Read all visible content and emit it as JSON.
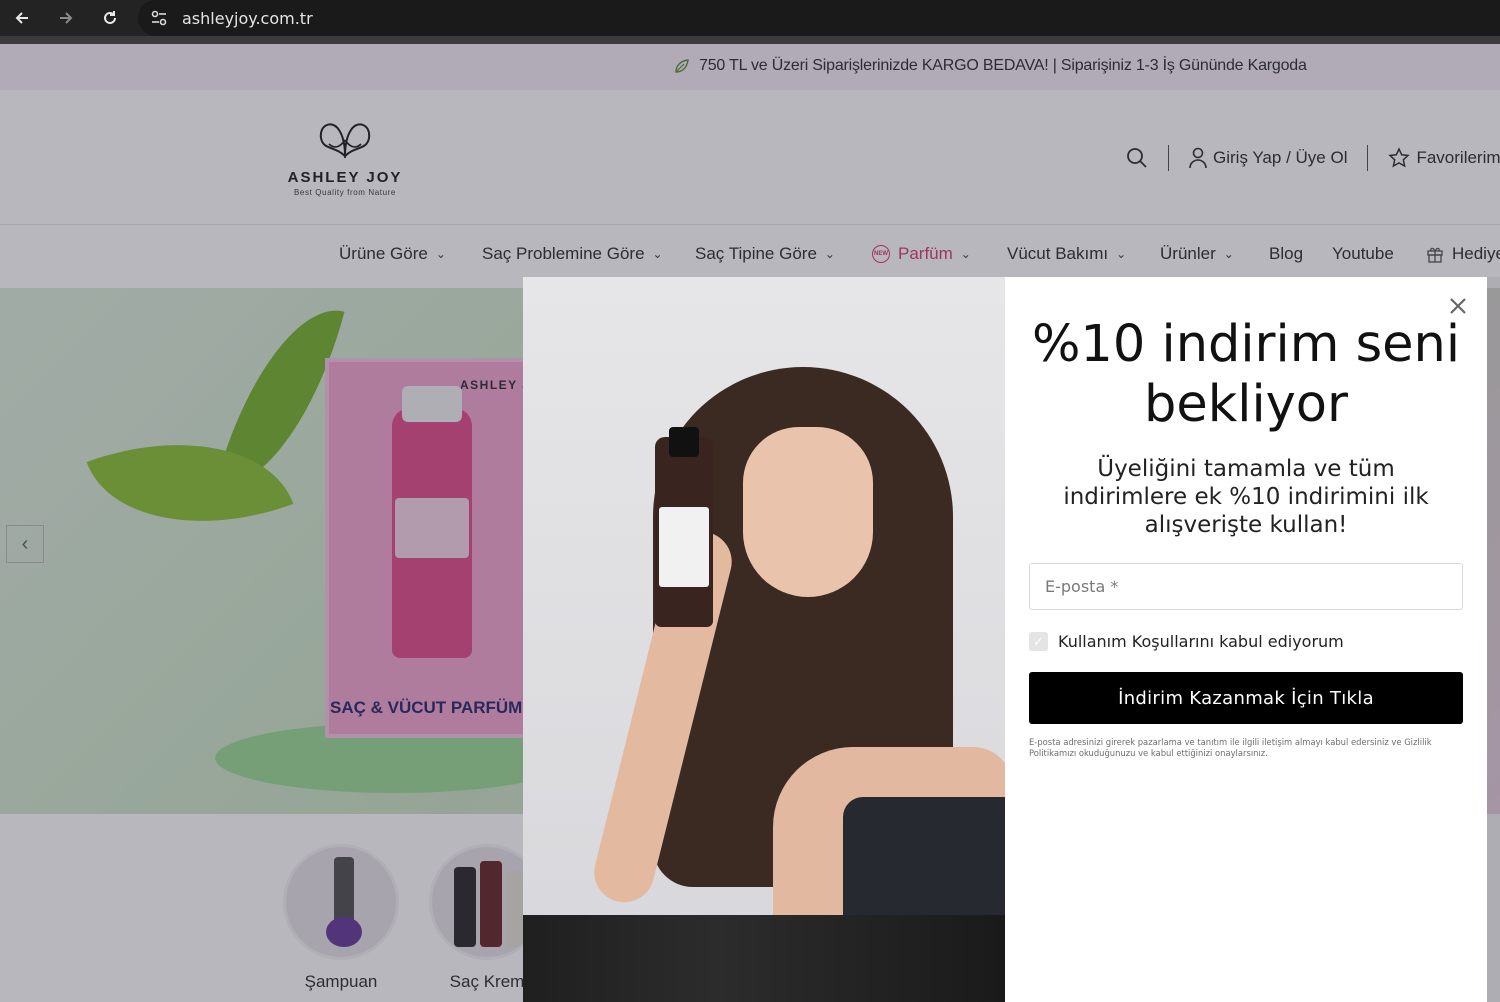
{
  "browser": {
    "url": "ashleyjoy.com.tr",
    "back_icon": "arrow-left-icon",
    "forward_icon": "arrow-right-icon",
    "reload_icon": "reload-icon",
    "site_info_icon": "tune-icon"
  },
  "announcement": {
    "text": "750 TL ve Üzeri Siparişlerinizde KARGO BEDAVA! | Siparişiniz 1-3 İş Gününde Kargoda",
    "icon": "leaf-icon"
  },
  "header": {
    "logo": {
      "brand": "ASHLEY JOY",
      "tagline": "Best Quality from Nature"
    },
    "search_icon": "search-icon",
    "login_label": "Giriş Yap / Üye Ol",
    "favorites_label": "Favorilerim"
  },
  "nav": {
    "items": [
      {
        "label": "Ürüne Göre",
        "has_dropdown": true
      },
      {
        "label": "Saç Problemine Göre",
        "has_dropdown": true
      },
      {
        "label": "Saç Tipine Göre",
        "has_dropdown": true
      },
      {
        "label": "Parfüm",
        "has_dropdown": true,
        "badge": "NEW",
        "accent": "#d9417a"
      },
      {
        "label": "Vücut Bakımı",
        "has_dropdown": true
      },
      {
        "label": "Ürünler",
        "has_dropdown": true
      },
      {
        "label": "Blog",
        "has_dropdown": false
      },
      {
        "label": "Youtube",
        "has_dropdown": false
      },
      {
        "label": "Hediye",
        "has_dropdown": false
      }
    ]
  },
  "hero": {
    "product_label": "SAÇ & VÜCUT PARFÜMÜ",
    "box_brand": "ASHLEY J"
  },
  "categories": [
    {
      "label": "Şampuan"
    },
    {
      "label": "Saç Krem"
    }
  ],
  "modal": {
    "title": "%10 indirim seni bekliyor",
    "subtitle": "Üyeliğini tamamla ve tüm indirimlere ek %10 indirimini ilk alışverişte kullan!",
    "email_placeholder": "E-posta *",
    "consent_label": "Kullanım Koşullarını kabul ediyorum",
    "cta_label": "İndirim Kazanmak İçin Tıkla",
    "legal_text": "E-posta adresinizi girerek pazarlama ve tanıtım ile ilgili iletişim almayı kabul edersiniz ve Gizlilik Politikamızı okuduğunuzu ve kabul ettiğinizi onaylarsınız.",
    "close_icon": "close-icon"
  },
  "colors": {
    "accent_pink": "#d9417a",
    "cta_bg": "#000000",
    "announcement_bg": "#f7eef6"
  }
}
